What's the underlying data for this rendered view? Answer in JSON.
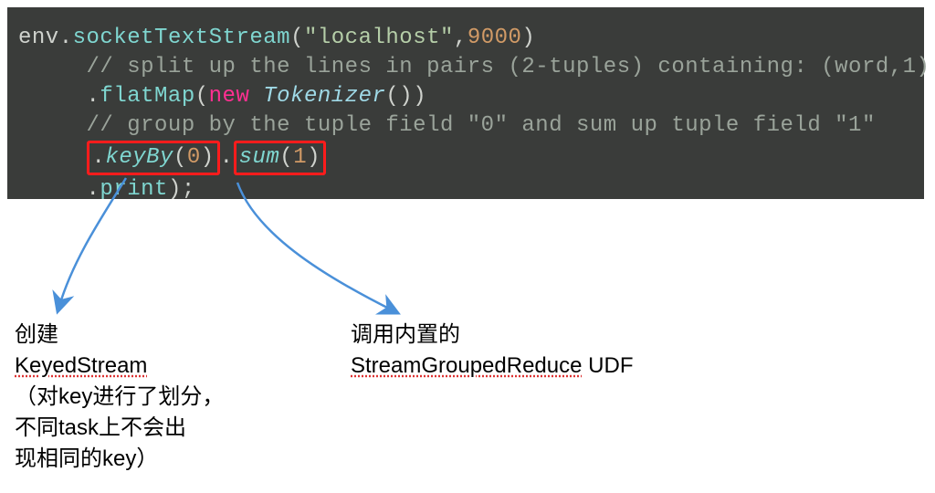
{
  "code": {
    "l1": {
      "env": "env",
      "dot1": ".",
      "m": "socketTextStream",
      "open": "(",
      "str": "\"localhost\"",
      "comma": ",",
      "num": "9000",
      "close": ")"
    },
    "l2": {
      "cmt": "// split up the lines in pairs (2-tuples) containing: (word,1)"
    },
    "l3": {
      "dot": ".",
      "m": "flatMap",
      "open": "(",
      "kw": "new",
      "sp": " ",
      "type": "Tokenizer",
      "paren": "()",
      "close": ")"
    },
    "l4": {
      "cmt": "// group by the tuple field \"0\" and sum up tuple field \"1\""
    },
    "l5": {
      "dot1": ".",
      "m1": "keyBy",
      "a1o": "(",
      "a1": "0",
      "a1c": ")",
      "dot2": ".",
      "m2": "sum",
      "a2o": "(",
      "a2": "1",
      "a2c": ")"
    },
    "l6": {
      "dot": ".",
      "m": "print",
      "open": "(",
      ")": "",
      ")semi": ");"
    }
  },
  "notes": {
    "left": {
      "l1": "创建",
      "l2": "KeyedStream",
      "l3": "（对key进行了划分，",
      "l4": "不同task上不会出",
      "l5": "现相同的key）"
    },
    "right": {
      "l1": "调用内置的",
      "l2_a": "StreamGroupedReduce",
      "l2_b": " UDF"
    }
  },
  "chart_data": null
}
